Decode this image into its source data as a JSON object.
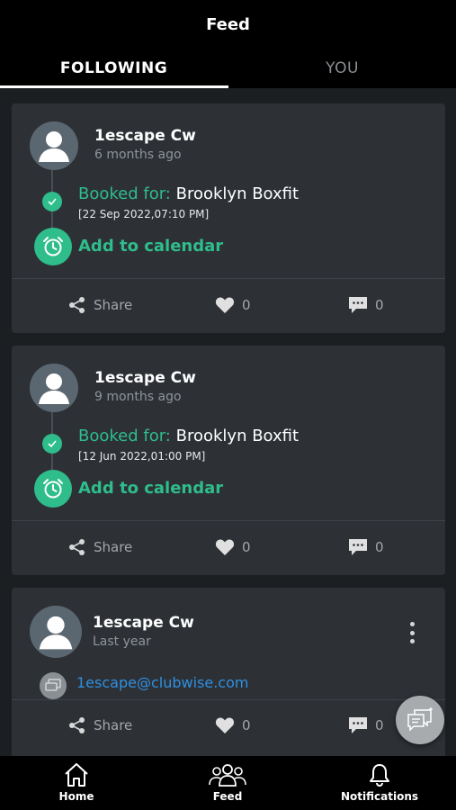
{
  "header": {
    "title": "Feed",
    "tabs": [
      {
        "label": "FOLLOWING",
        "active": true
      },
      {
        "label": "YOU",
        "active": false
      }
    ]
  },
  "feed": {
    "posts": [
      {
        "user": "1escape Cw",
        "time": "6 months ago",
        "booked_label": "Booked for:",
        "booked_class": "Brooklyn Boxfit",
        "booked_date": "[22 Sep 2022,07:10 PM]",
        "calendar_label": "Add to calendar",
        "share_label": "Share",
        "likes": "0",
        "comments": "0"
      },
      {
        "user": "1escape Cw",
        "time": "9 months ago",
        "booked_label": "Booked for:",
        "booked_class": "Brooklyn Boxfit",
        "booked_date": "[12 Jun 2022,01:00 PM]",
        "calendar_label": "Add to calendar",
        "share_label": "Share",
        "likes": "0",
        "comments": "0"
      },
      {
        "user": "1escape Cw",
        "time": "Last year",
        "email": "1escape@clubwise.com",
        "share_label": "Share",
        "likes": "0",
        "comments": "0"
      }
    ]
  },
  "bottom_nav": {
    "items": [
      {
        "label": "Home",
        "icon": "home-icon"
      },
      {
        "label": "Feed",
        "icon": "people-icon"
      },
      {
        "label": "Notifications",
        "icon": "bell-icon"
      }
    ]
  },
  "colors": {
    "accent": "#2ebd8b",
    "link": "#2f8fe0",
    "card": "#2d3136",
    "background": "#1c1f22"
  }
}
